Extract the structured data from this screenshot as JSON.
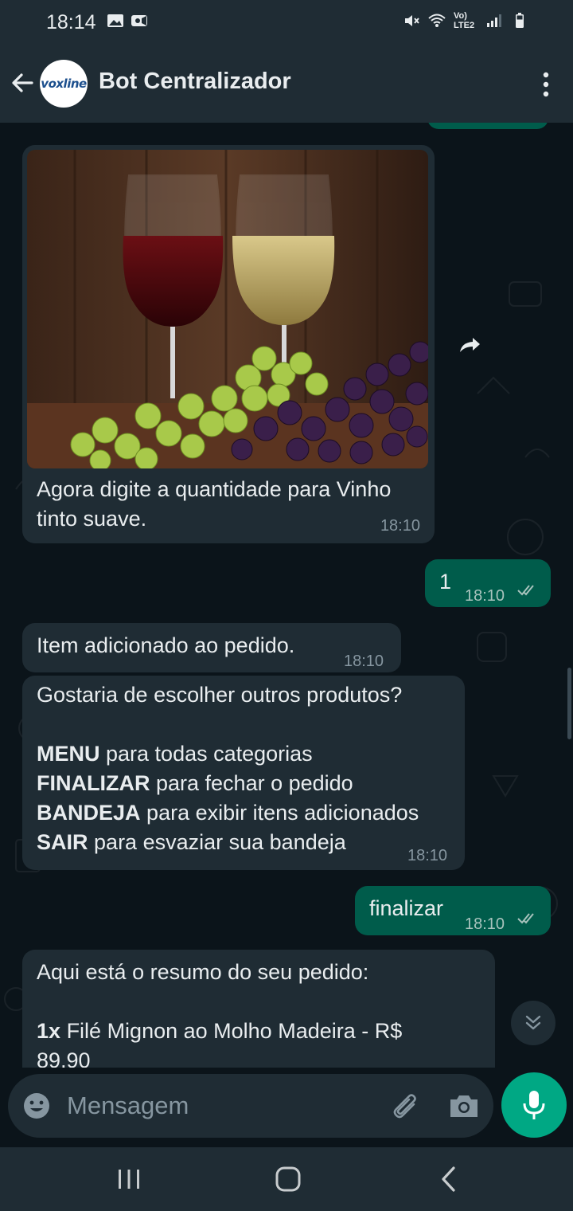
{
  "status_bar": {
    "time": "18:14",
    "network": "Vo) LTE2"
  },
  "header": {
    "title": "Bot Centralizador",
    "avatar_logo": "voxline"
  },
  "messages": [
    {
      "type": "image",
      "direction": "incoming",
      "image": "wine-glasses-and-grapes",
      "caption": "Agora digite a quantidade para Vinho tinto suave.",
      "time": "18:10"
    },
    {
      "type": "text",
      "direction": "outgoing",
      "text": "1",
      "time": "18:10",
      "status": "read"
    },
    {
      "type": "text",
      "direction": "incoming",
      "text": "Item adicionado ao pedido.",
      "time": "18:10"
    },
    {
      "type": "text",
      "direction": "incoming",
      "intro": "Gostaria de escolher outros produtos?",
      "options": [
        {
          "keyword": "MENU",
          "description": "para todas categorias"
        },
        {
          "keyword": "FINALIZAR",
          "description": "para fechar o pedido"
        },
        {
          "keyword": "BANDEJA",
          "description": "para exibir itens adicionados"
        },
        {
          "keyword": "SAIR",
          "description": "para esvaziar sua bandeja"
        }
      ],
      "time": "18:10"
    },
    {
      "type": "text",
      "direction": "outgoing",
      "text": "finalizar",
      "time": "18:10",
      "status": "read"
    },
    {
      "type": "text",
      "direction": "incoming",
      "intro": "Aqui está o resumo do seu pedido:",
      "item_qty": "1x",
      "item_desc": "Filé Mignon ao Molho Madeira - R$",
      "item_price": "89,90"
    }
  ],
  "input": {
    "placeholder": "Mensagem"
  },
  "colors": {
    "background": "#0b141a",
    "bar": "#1f2c34",
    "incoming_bubble": "#1f2c34",
    "outgoing_bubble": "#005c4b",
    "accent": "#00a884",
    "timestamp": "#8696a0"
  },
  "icons": [
    "back-arrow-icon",
    "more-vert-icon",
    "forward-icon",
    "double-check-icon",
    "chevron-double-down-icon",
    "emoji-icon",
    "paperclip-icon",
    "camera-icon",
    "mic-icon",
    "recents-icon",
    "home-icon",
    "nav-back-icon"
  ]
}
